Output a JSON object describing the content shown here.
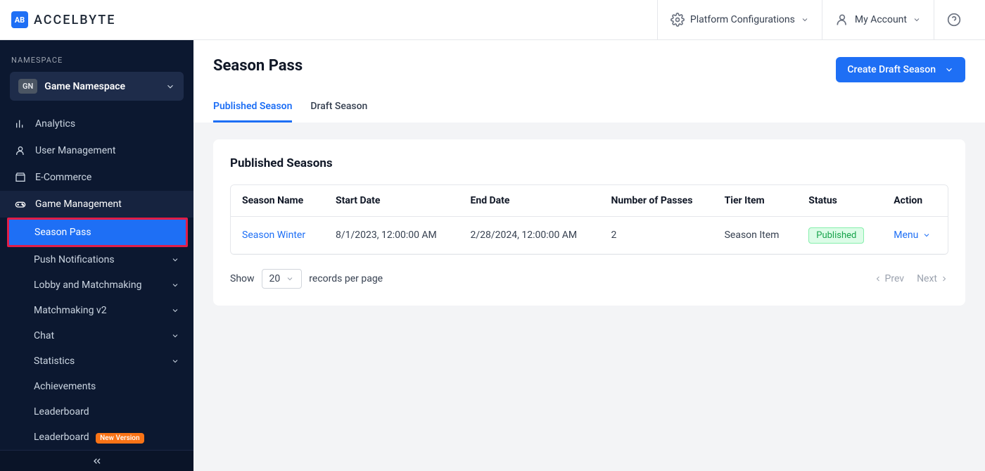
{
  "brand": {
    "logo_letters": "AB",
    "name": "ACCELBYTE"
  },
  "header": {
    "platform_configs": "Platform Configurations",
    "my_account": "My Account"
  },
  "sidebar": {
    "namespace_label": "NAMESPACE",
    "ns_badge": "GN",
    "ns_name": "Game Namespace",
    "items": {
      "analytics": "Analytics",
      "user_management": "User Management",
      "ecommerce": "E-Commerce",
      "game_management": "Game Management"
    },
    "sub": {
      "season_pass": "Season Pass",
      "push_notifications": "Push Notifications",
      "lobby_matchmaking": "Lobby and Matchmaking",
      "matchmaking_v2": "Matchmaking v2",
      "chat": "Chat",
      "statistics": "Statistics",
      "achievements": "Achievements",
      "leaderboard": "Leaderboard",
      "leaderboard2": "Leaderboard",
      "new_version_badge": "New Version"
    }
  },
  "page": {
    "title": "Season Pass",
    "create_button": "Create Draft Season",
    "tabs": {
      "published": "Published Season",
      "draft": "Draft Season"
    },
    "card_title": "Published Seasons",
    "columns": {
      "season_name": "Season Name",
      "start_date": "Start Date",
      "end_date": "End Date",
      "number_passes": "Number of Passes",
      "tier_item": "Tier Item",
      "status": "Status",
      "action": "Action"
    },
    "rows": [
      {
        "season_name": "Season Winter",
        "start_date": "8/1/2023, 12:00:00 AM",
        "end_date": "2/28/2024, 12:00:00 AM",
        "number_passes": "2",
        "tier_item": "Season Item",
        "status": "Published",
        "action": "Menu"
      }
    ],
    "footer": {
      "show": "Show",
      "per_page_value": "20",
      "records_per_page": "records per page",
      "prev": "Prev",
      "next": "Next"
    }
  }
}
